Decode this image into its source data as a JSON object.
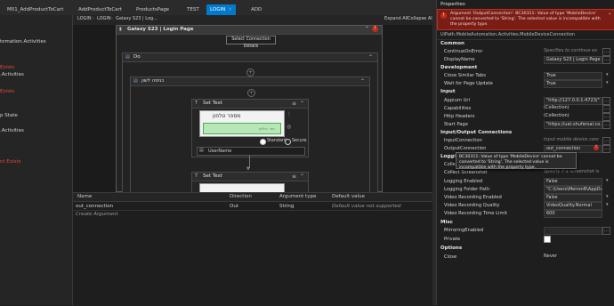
{
  "tabs": [
    {
      "label": "M01_AddProductToCart",
      "active": false
    },
    {
      "label": "AddProductToCart",
      "active": false
    },
    {
      "label": "ProductsPage",
      "active": false
    },
    {
      "label": "TEST",
      "active": false
    },
    {
      "label": "LOGIN",
      "active": true
    },
    {
      "label": "ADD",
      "active": false
    }
  ],
  "left_panel": {
    "items": [
      {
        "text": "tomation.Activities",
        "tone": "w"
      },
      {
        "text": "Exists",
        "tone": "r"
      },
      {
        "text": ".Activities",
        "tone": "w"
      },
      {
        "text": "Exists",
        "tone": "r"
      },
      {
        "text": "p State",
        "tone": "w"
      },
      {
        "text": ".Activities",
        "tone": "w"
      },
      {
        "text": "nt Exists",
        "tone": "r"
      }
    ]
  },
  "breadcrumb": {
    "items": [
      "LOGIN",
      "LOGIN",
      "Galaxy S23 | Log..."
    ],
    "expand_all": "Expand All",
    "collapse_all": "Collapse All"
  },
  "designer": {
    "outer_title": "Galaxy S23 | Login Page",
    "select_connection": "Select Connection Details",
    "do_label": "Do",
    "inner_label": "כניסה לשון",
    "set_text_1": {
      "title": "Set Text",
      "preview_text": "מספר טלפון",
      "field_hint": "מס׳ טלפון",
      "option_standard": "Standard",
      "option_secure": "Secure",
      "value": "UserName"
    },
    "set_text_2": {
      "title": "Set Text"
    }
  },
  "arguments": {
    "headers": [
      "Name",
      "Direction",
      "Argument type",
      "Default value"
    ],
    "rows": [
      {
        "name": "out_connection",
        "direction": "Out",
        "type": "String",
        "default": "Default value not supported"
      }
    ],
    "create_label": "Create Argument"
  },
  "properties": {
    "title": "Properties",
    "error_text": "Argument 'OutputConnection': BC30311: Value of type 'MobileDevice' cannot be converted to 'String'. The selected value is incompatible with the property type.",
    "type_name": "UiPath.MobileAutomation.Activities.MobileDeviceConnection",
    "sections": [
      {
        "name": "Common",
        "rows": [
          {
            "name": "ContinueOnError",
            "value": "Specifies to continue ex",
            "style": "ital"
          },
          {
            "name": "DisplayName",
            "value": "Galaxy S23 | Login Page",
            "style": "box"
          }
        ]
      },
      {
        "name": "Development",
        "rows": [
          {
            "name": "Close Similar Tabs",
            "value": "True",
            "style": "box",
            "dropdown": true
          },
          {
            "name": "Wait for Page Update",
            "value": "True",
            "style": "box",
            "dropdown": true
          }
        ]
      },
      {
        "name": "Input",
        "rows": [
          {
            "name": "Appium Url",
            "value": "\"http://127.0.0.1:4723/\"",
            "style": "box"
          },
          {
            "name": "Capabilities",
            "value": "(Collection)",
            "style": "plain"
          },
          {
            "name": "Http Headers",
            "value": "(Collection)",
            "style": "plain"
          },
          {
            "name": "Start Page",
            "value": "\"https://uat.shufersal.co.il/",
            "style": "box"
          }
        ]
      },
      {
        "name": "Input/Output Connections",
        "rows": [
          {
            "name": "InputConnection",
            "value": "Input mobile device conne",
            "style": "ital"
          },
          {
            "name": "OutputConnection",
            "value": "out_connection",
            "style": "box",
            "error": true
          }
        ]
      },
      {
        "name": "Logging",
        "rows": [
          {
            "name": "Collect",
            "value": "",
            "style": "plain"
          },
          {
            "name": "Collect Screenshot",
            "value": "Specify if a screenshot is re",
            "style": "ital"
          },
          {
            "name": "Logging Enabled",
            "value": "False",
            "style": "box",
            "dropdown": true
          },
          {
            "name": "Logging Folder Path",
            "value": "\"C:\\Users\\MeironB\\AppDa",
            "style": "box"
          },
          {
            "name": "Video Recording Enabled",
            "value": "False",
            "style": "box",
            "dropdown": true
          },
          {
            "name": "Video Recording Quality",
            "value": "VideoQuality.Normal",
            "style": "box",
            "dropdown": true
          },
          {
            "name": "Video Recording Time Limit",
            "value": "600",
            "style": "box"
          }
        ]
      },
      {
        "name": "Misc",
        "rows": [
          {
            "name": "MirroringEnabled",
            "value": "",
            "style": "box"
          },
          {
            "name": "Private",
            "value": "",
            "style": "checkbox"
          }
        ]
      },
      {
        "name": "Options",
        "rows": [
          {
            "name": "Close",
            "value": "Never",
            "style": "plain",
            "dropdown": true
          }
        ]
      }
    ],
    "tooltip": "BC30311: Value of type 'MobileDevice' cannot be converted to 'String'. The selected value is incompatible with the property type."
  },
  "colors": {
    "accent": "#007acc",
    "error": "#c42b1c",
    "error_text": "#e8463a",
    "success": "#4caf50"
  }
}
